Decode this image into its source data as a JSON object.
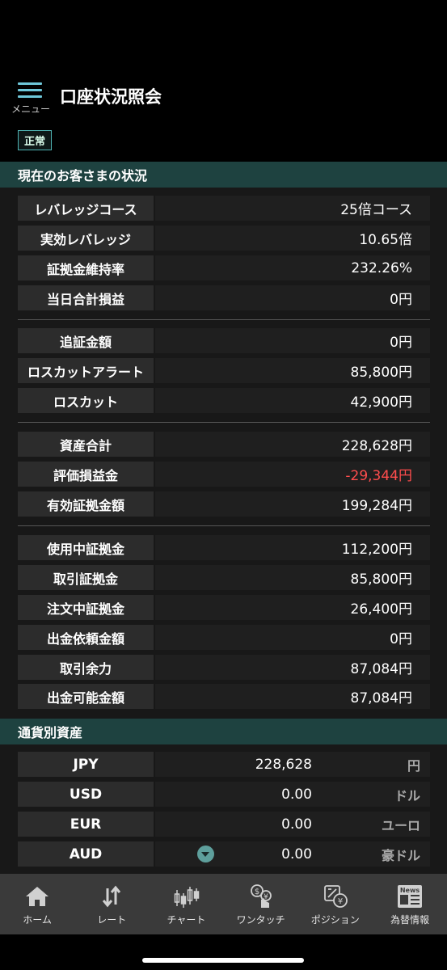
{
  "header": {
    "menu_label": "メニュー",
    "title": "口座状況照会"
  },
  "status": {
    "badge": "正常"
  },
  "summary": {
    "section_title": "現在のお客さまの状況",
    "groups": [
      [
        {
          "label": "レバレッジコース",
          "value": "25倍コース"
        },
        {
          "label": "実効レバレッジ",
          "value": "10.65倍"
        },
        {
          "label": "証拠金維持率",
          "value": "232.26%"
        },
        {
          "label": "当日合計損益",
          "value": "0円"
        }
      ],
      [
        {
          "label": "追証金額",
          "value": "0円"
        },
        {
          "label": "ロスカットアラート",
          "value": "85,800円"
        },
        {
          "label": "ロスカット",
          "value": "42,900円"
        }
      ],
      [
        {
          "label": "資産合計",
          "value": "228,628円"
        },
        {
          "label": "評価損益金",
          "value": "-29,344円"
        },
        {
          "label": "有効証拠金額",
          "value": "199,284円"
        }
      ],
      [
        {
          "label": "使用中証拠金",
          "value": "112,200円"
        },
        {
          "label": "取引証拠金",
          "value": "85,800円"
        },
        {
          "label": "注文中証拠金",
          "value": "26,400円"
        },
        {
          "label": "出金依頼金額",
          "value": "0円"
        },
        {
          "label": "取引余力",
          "value": "87,084円"
        },
        {
          "label": "出金可能金額",
          "value": "87,084円"
        }
      ]
    ]
  },
  "currency": {
    "section_title": "通貨別資産",
    "rows": [
      {
        "code": "JPY",
        "amount": "228,628",
        "unit": "円"
      },
      {
        "code": "USD",
        "amount": "0.00",
        "unit": "ドル"
      },
      {
        "code": "EUR",
        "amount": "0.00",
        "unit": "ユーロ"
      },
      {
        "code": "AUD",
        "amount": "0.00",
        "unit": "豪ドル"
      }
    ]
  },
  "tabs": [
    {
      "label": "ホーム",
      "icon": "home-icon"
    },
    {
      "label": "レート",
      "icon": "rate-arrows-icon"
    },
    {
      "label": "チャート",
      "icon": "candlestick-chart-icon"
    },
    {
      "label": "ワンタッチ",
      "icon": "one-touch-icon"
    },
    {
      "label": "ポジション",
      "icon": "position-icon"
    },
    {
      "label": "為替情報",
      "icon": "news-icon"
    }
  ],
  "colors": {
    "accent": "#1e4240",
    "negative": "#ff4d4d",
    "badge_border": "#4fb3b3"
  }
}
